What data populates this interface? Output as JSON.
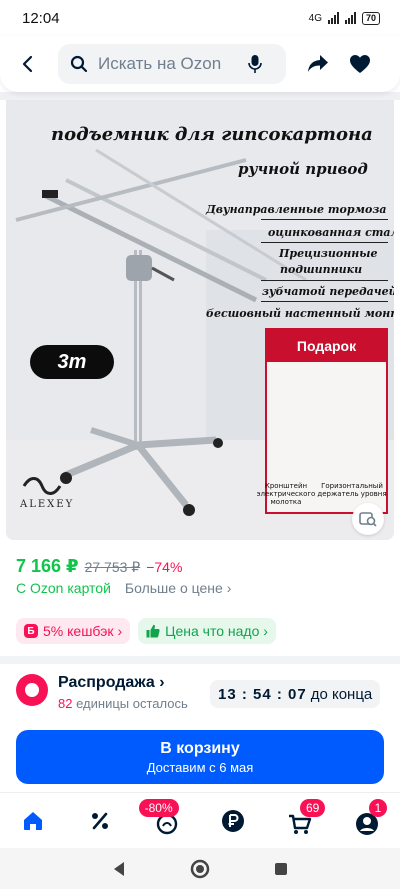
{
  "status_bar": {
    "time": "12:04",
    "network": "4G",
    "battery": "70"
  },
  "header": {
    "search_placeholder": "Искать на Ozon",
    "icons": [
      "back-arrow-icon",
      "search-icon",
      "microphone-icon",
      "share-icon",
      "heart-icon"
    ]
  },
  "product_image": {
    "title": "подъемник для гипсокартона",
    "subtitle": "ручной привод",
    "features": [
      "Двунаправленные тормоза",
      "оцинкованная сталь",
      "Прецизионные",
      "подшипники",
      "зубчатой передачей",
      "бесшовный настенный монтаж"
    ],
    "height_badge": "3m",
    "gift_label": "Подарок",
    "gift_caption_1": "Кронштейн электрического молотка",
    "gift_caption_2": "Горизонтальный держатель уровня",
    "brand": "ALEXEY"
  },
  "price": {
    "current": "7 166 ₽",
    "old": "27 753 ₽",
    "discount": "−74%",
    "card_label": "С Ozon картой",
    "more_label": "Больше о цене ›"
  },
  "chips": {
    "cashback": "5% кешбэк ›",
    "cashback_icon_letter": "Б",
    "fair_price": "Цена что надо ›"
  },
  "sale": {
    "title": "Распродажа ›",
    "units_count": "82",
    "units_text": "единицы осталось",
    "timer": "13 : 54 : 07",
    "timer_suffix": "до конца"
  },
  "cart": {
    "label": "В корзину",
    "delivery": "Доставим с 6 мая"
  },
  "tabbar": {
    "promo_badge": "-80%",
    "cart_badge": "69",
    "profile_badge": "1"
  },
  "colors": {
    "ozon_blue": "#005bff",
    "price_green": "#10c44c",
    "accent_pink": "#f91155"
  }
}
